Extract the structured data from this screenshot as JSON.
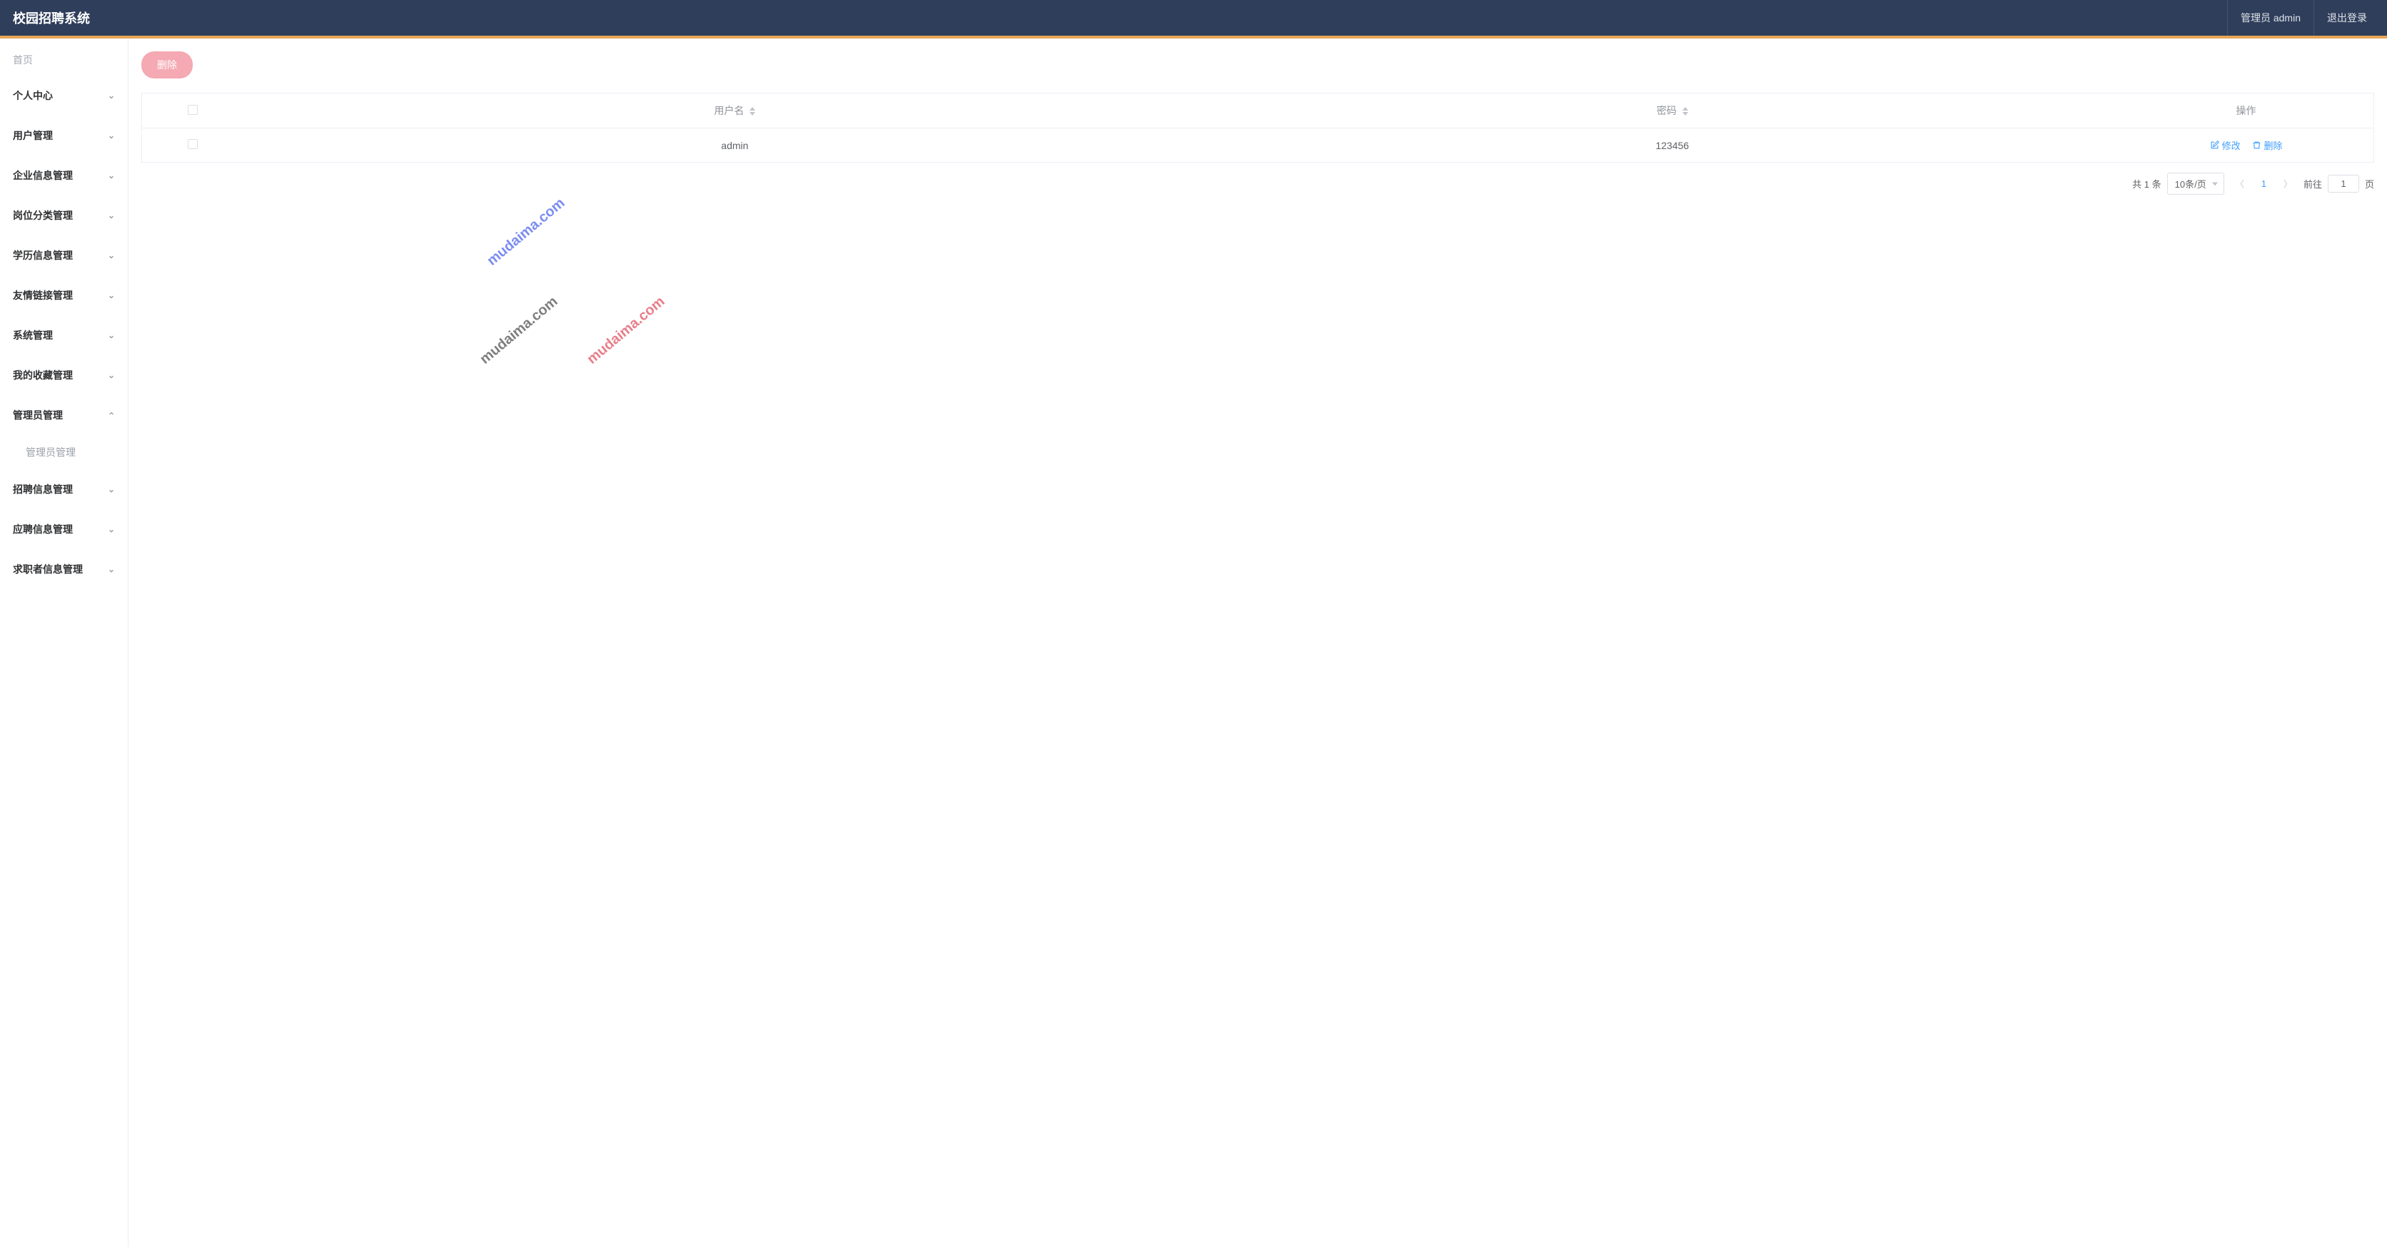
{
  "header": {
    "title": "校园招聘系统",
    "admin_label": "管理员 admin",
    "logout_label": "退出登录"
  },
  "sidebar": {
    "home": "首页",
    "items": [
      {
        "label": "个人中心",
        "expanded": false
      },
      {
        "label": "用户管理",
        "expanded": false
      },
      {
        "label": "企业信息管理",
        "expanded": false
      },
      {
        "label": "岗位分类管理",
        "expanded": false
      },
      {
        "label": "学历信息管理",
        "expanded": false
      },
      {
        "label": "友情链接管理",
        "expanded": false
      },
      {
        "label": "系统管理",
        "expanded": false
      },
      {
        "label": "我的收藏管理",
        "expanded": false
      },
      {
        "label": "管理员管理",
        "expanded": true,
        "children": [
          {
            "label": "管理员管理"
          }
        ]
      },
      {
        "label": "招聘信息管理",
        "expanded": false
      },
      {
        "label": "应聘信息管理",
        "expanded": false
      },
      {
        "label": "求职者信息管理",
        "expanded": false
      }
    ]
  },
  "toolbar": {
    "delete_label": "删除"
  },
  "table": {
    "columns": {
      "username": "用户名",
      "password": "密码",
      "action": "操作"
    },
    "rows": [
      {
        "username": "admin",
        "password": "123456"
      }
    ],
    "actions": {
      "edit": "修改",
      "delete": "删除"
    }
  },
  "pagination": {
    "total_text": "共 1 条",
    "per_page": "10条/页",
    "current_page": "1",
    "goto_prefix": "前往",
    "goto_value": "1",
    "goto_suffix": "页"
  },
  "watermark": "mudaima.com"
}
